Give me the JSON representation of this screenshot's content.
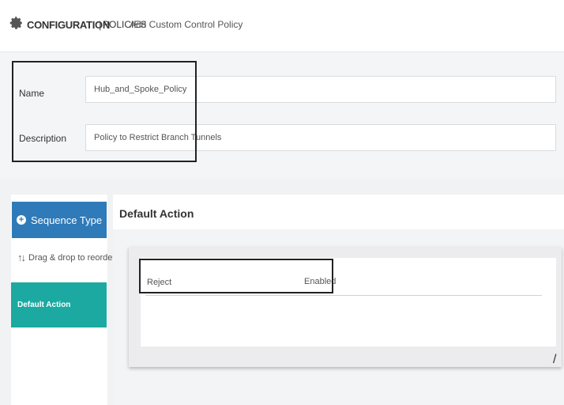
{
  "header": {
    "section": "CONFIGURATION",
    "separator": "|",
    "subsection": "POLICIES",
    "page_title": "Add Custom Control Policy",
    "icon": "gear-icon"
  },
  "form": {
    "name_label": "Name",
    "name_value": "Hub_and_Spoke_Policy",
    "description_label": "Description",
    "description_value": "Policy to Restrict Branch Tunnels"
  },
  "sidebar": {
    "sequence_type_label": "Sequence Type",
    "drag_label": "Drag & drop to reorder",
    "default_action_label": "Default Action"
  },
  "main": {
    "title": "Default Action",
    "action_name": "Reject",
    "action_status": "Enabled"
  },
  "colors": {
    "accent_blue": "#2f7ab8",
    "accent_teal": "#1ba9a1"
  }
}
